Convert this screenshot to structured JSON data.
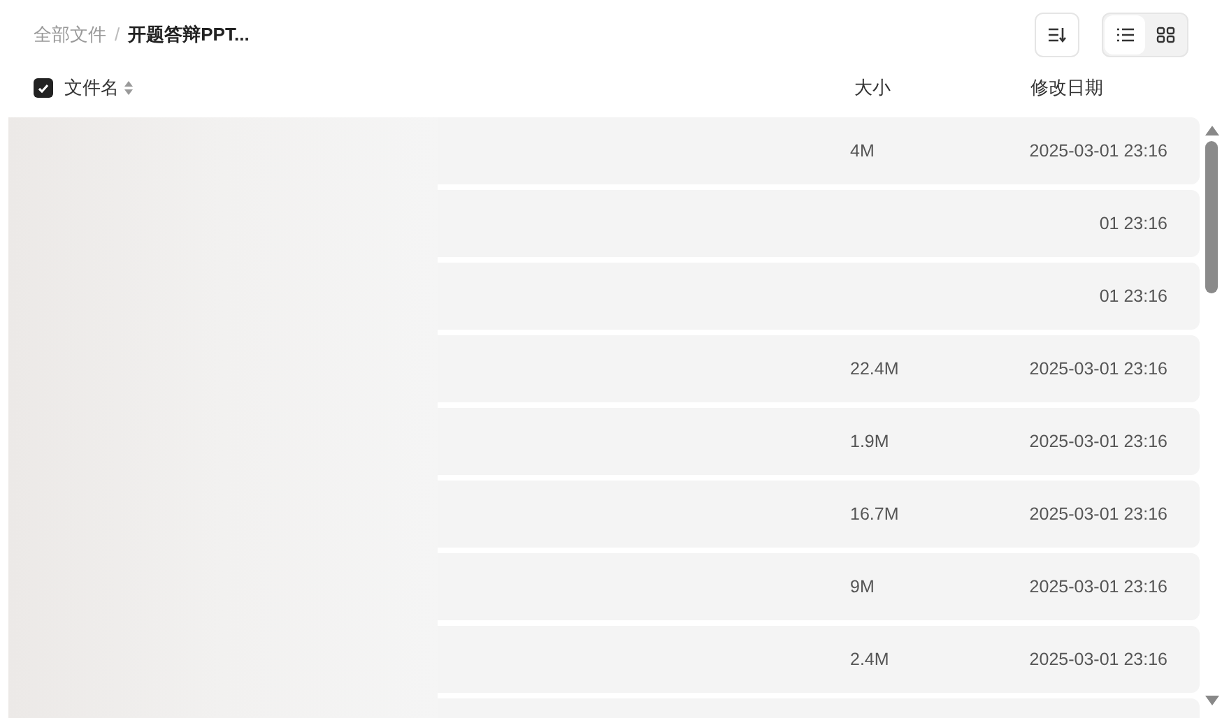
{
  "breadcrumb": [
    {
      "label": "全部文件",
      "current": false
    },
    {
      "label": "开题答辩PPT...",
      "current": true
    }
  ],
  "breadcrumb_separator": "/",
  "view_toggle": [
    {
      "kind": "list",
      "selected": true
    },
    {
      "kind": "grid",
      "selected": false
    }
  ],
  "table": {
    "select_all": {
      "checked": true
    },
    "columns": [
      "文件名",
      "大小",
      "修改日期"
    ],
    "rows": [
      {
        "size": "4M",
        "date": "2025-03-01 23:16"
      },
      {
        "date": "01 23:16"
      },
      {
        "date": "01 23:16"
      },
      {
        "size": "22.4M",
        "date": "2025-03-01 23:16"
      },
      {
        "size": "1.9M",
        "date": "2025-03-01 23:16"
      },
      {
        "size": "16.7M",
        "date": "2025-03-01 23:16"
      },
      {
        "size": "9M",
        "date": "2025-03-01 23:16"
      },
      {
        "size": "2.4M",
        "date": "2025-03-01 23:16"
      },
      {}
    ]
  }
}
